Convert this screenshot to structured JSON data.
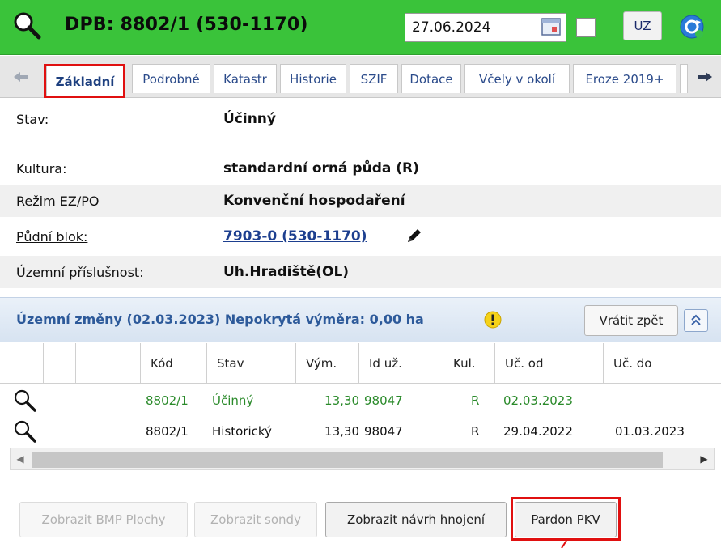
{
  "header": {
    "title": "DPB: 8802/1 (530-1170)",
    "date_value": "27.06.2024",
    "uz_label": "UZ",
    "accent_color": "#3ac33a",
    "icons": [
      "search-icon",
      "calendar-icon",
      "refresh-icon"
    ]
  },
  "tabs": [
    {
      "label": "Základní",
      "active": true
    },
    {
      "label": "Podrobné"
    },
    {
      "label": "Katastr"
    },
    {
      "label": "Historie"
    },
    {
      "label": "SZIF"
    },
    {
      "label": "Dotace"
    },
    {
      "label": "Včely v okolí"
    },
    {
      "label": "Eroze 2019+"
    }
  ],
  "details": {
    "stav": {
      "label": "Stav:",
      "value": "Účinný"
    },
    "kultura": {
      "label": "Kultura:",
      "value": "standardní orná půda (R)"
    },
    "rezim": {
      "label": "Režim EZ/PO",
      "value": "Konvenční hospodaření"
    },
    "pudni_blok": {
      "label": "Půdní blok:",
      "value": "7903-0 (530-1170)"
    },
    "uzemni": {
      "label": "Územní příslušnost:",
      "value": "Uh.Hradiště(OL)"
    }
  },
  "section": {
    "title": "Územní změny (02.03.2023) Nepokrytá výměra: 0,00 ha",
    "revert_label": "Vrátit zpět"
  },
  "table": {
    "columns": [
      "Kód",
      "Stav",
      "Vým.",
      "Id už.",
      "Kul.",
      "Uč. od",
      "Uč. do"
    ],
    "rows": [
      {
        "kod": "8802/1",
        "stav": "Účinný",
        "vym": "13,30",
        "id": "98047",
        "kul": "R",
        "od": "02.03.2023",
        "do": "",
        "color": "#2a8a2a"
      },
      {
        "kod": "8802/1",
        "stav": "Historický",
        "vym": "13,30",
        "id": "98047",
        "kul": "R",
        "od": "29.04.2022",
        "do": "01.03.2023",
        "color": "#111111"
      }
    ]
  },
  "buttons": {
    "bmp": "Zobrazit BMP Plochy",
    "sondy": "Zobrazit sondy",
    "hnojeni": "Zobrazit návrh hnojení",
    "pardon": "Pardon PKV"
  }
}
